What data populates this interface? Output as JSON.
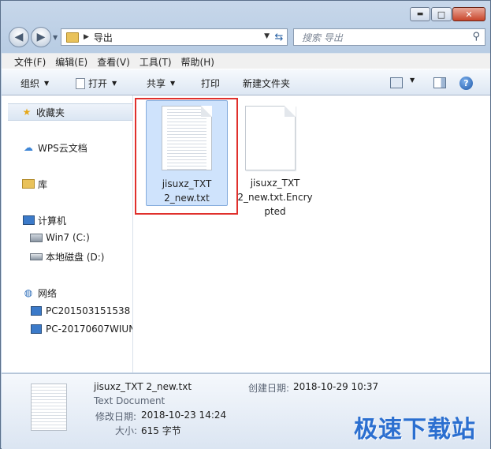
{
  "window": {
    "minimize_label": "▭",
    "maximize_label": "□",
    "close_label": "✕"
  },
  "address": {
    "path": "导出",
    "search_placeholder": "搜索 导出"
  },
  "menu": [
    "文件(F)",
    "编辑(E)",
    "查看(V)",
    "工具(T)",
    "帮助(H)"
  ],
  "toolbar": {
    "organize": "组织",
    "open": "打开",
    "share": "共享",
    "print": "打印",
    "new_folder": "新建文件夹"
  },
  "nav": {
    "favorites": "收藏夹",
    "wps": "WPS云文档",
    "library": "库",
    "computer": "计算机",
    "drive_c": "Win7 (C:)",
    "drive_d": "本地磁盘 (D:)",
    "network": "网络",
    "pc1": "PC201503151538",
    "pc2": "PC-20170607WIUN"
  },
  "files": [
    {
      "line1": "jisuxz_TXT",
      "line2": "2_new.txt",
      "line3": ""
    },
    {
      "line1": "jisuxz_TXT",
      "line2": "2_new.txt.Encry",
      "line3": "pted"
    }
  ],
  "details": {
    "filename": "jisuxz_TXT 2_new.txt",
    "type": "Text Document",
    "modified_label": "修改日期:",
    "modified_value": "2018-10-23 14:24",
    "size_label": "大小:",
    "size_value": "615 字节",
    "created_label": "创建日期:",
    "created_value": "2018-10-29 10:37"
  },
  "watermark": "极速下载站",
  "colors": {
    "accent": "#2b6fd0",
    "selection": "#cfe3fc",
    "highlight_box": "#e0302c"
  }
}
